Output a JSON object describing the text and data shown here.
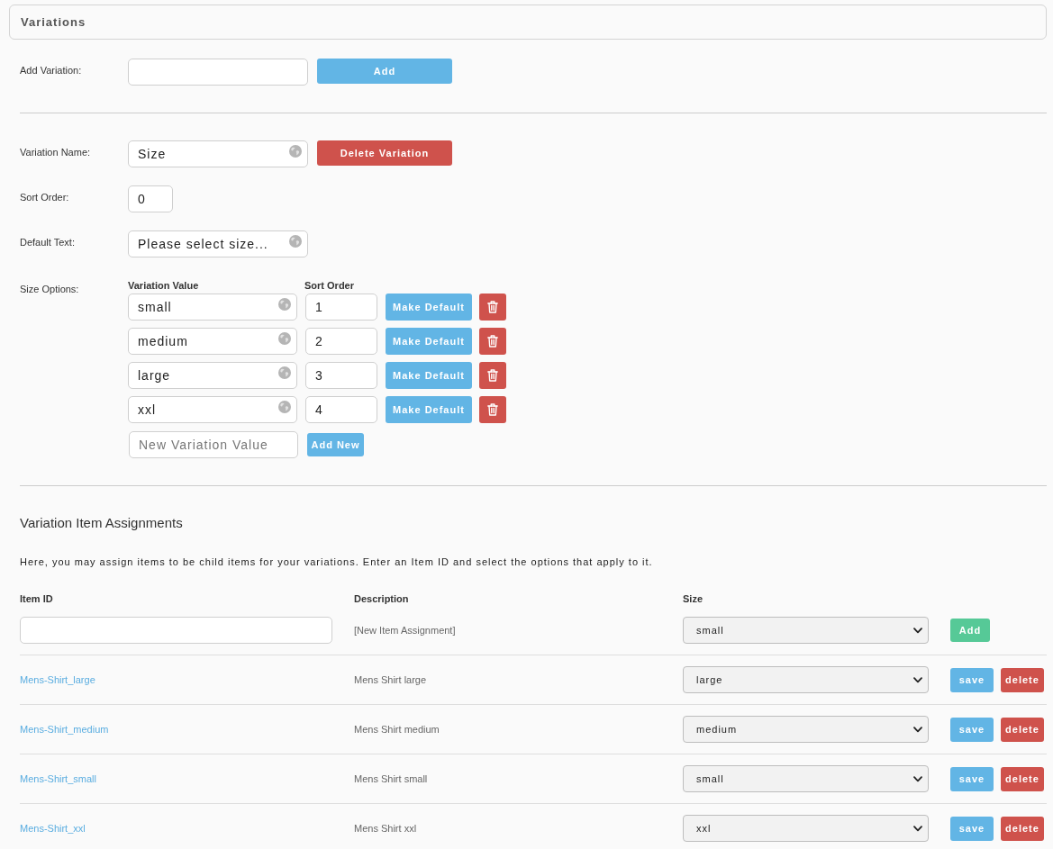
{
  "panel": {
    "title": "Variations"
  },
  "add_variation": {
    "label": "Add Variation:",
    "button": "Add"
  },
  "variation": {
    "name_label": "Variation Name:",
    "name": "Size",
    "delete_button": "Delete Variation",
    "sort_label": "Sort Order:",
    "sort_order": "0",
    "default_text_label": "Default Text:",
    "default_text": "Please select size...",
    "options_label": "Size Options:",
    "columns": [
      "Variation Value",
      "Sort Order"
    ],
    "options": [
      {
        "value": "small",
        "sort_order": "1",
        "button": "Make Default"
      },
      {
        "value": "medium",
        "sort_order": "2",
        "button": "Make Default"
      },
      {
        "value": "large",
        "sort_order": "3",
        "button": "Make Default"
      },
      {
        "value": "xxl",
        "sort_order": "4",
        "button": "Make Default"
      }
    ],
    "new_value": {
      "placeholder": "New Variation Value",
      "button": "Add New"
    }
  },
  "assignments": {
    "title": "Variation Item Assignments",
    "description": "Here, you may assign items to be child items for your variations. Enter an Item ID and select the options that apply to it.",
    "columns": [
      "Item ID",
      "Description",
      "Size"
    ],
    "new_row": {
      "description": "[New Item Assignment]",
      "size": "small",
      "button": "Add"
    },
    "rows": [
      {
        "item_id": "Mens-Shirt_large",
        "description": "Mens Shirt large",
        "size": "large",
        "save": "save",
        "delete": "delete"
      },
      {
        "item_id": "Mens-Shirt_medium",
        "description": "Mens Shirt medium",
        "size": "medium",
        "save": "save",
        "delete": "delete"
      },
      {
        "item_id": "Mens-Shirt_small",
        "description": "Mens Shirt small",
        "size": "small",
        "save": "save",
        "delete": "delete"
      },
      {
        "item_id": "Mens-Shirt_xxl",
        "description": "Mens Shirt xxl",
        "size": "xxl",
        "save": "save",
        "delete": "delete"
      }
    ]
  }
}
